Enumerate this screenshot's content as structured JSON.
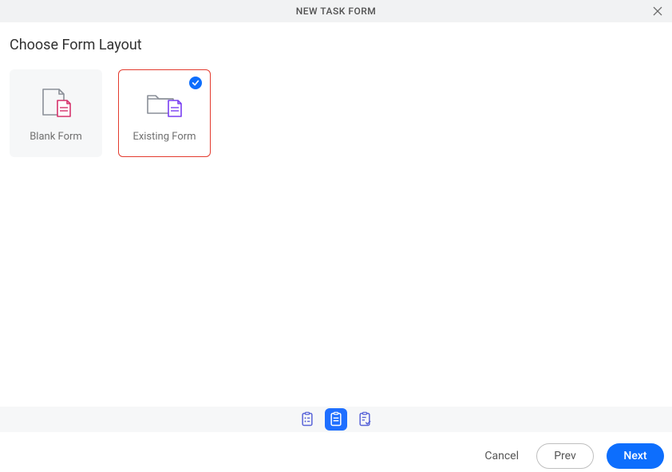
{
  "header": {
    "title": "NEW TASK FORM",
    "close_icon": "close"
  },
  "section": {
    "title": "Choose Form Layout"
  },
  "cards": {
    "blank": {
      "label": "Blank Form",
      "selected": false
    },
    "existing": {
      "label": "Existing Form",
      "selected": true
    }
  },
  "stepper": {
    "step1": "form-list",
    "step2": "form-layout",
    "step3": "form-confirm",
    "active_index": 1
  },
  "footer": {
    "cancel": "Cancel",
    "prev": "Prev",
    "next": "Next"
  },
  "colors": {
    "primary": "#0d6efd",
    "selected_border": "#e33b2e",
    "muted_bg": "#f6f7f8"
  }
}
